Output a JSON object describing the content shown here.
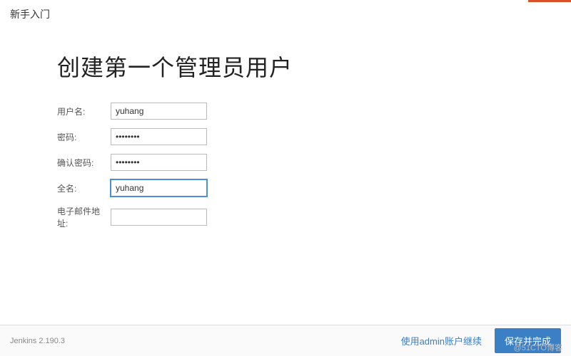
{
  "header": {
    "title": "新手入门"
  },
  "main": {
    "page_title": "创建第一个管理员用户",
    "form": {
      "username_label": "用户名:",
      "username_value": "yuhang",
      "password_label": "密码:",
      "password_value": "••••••••",
      "confirm_password_label": "确认密码:",
      "confirm_password_value": "••••••••",
      "fullname_label": "全名:",
      "fullname_value": "yuhang",
      "email_label": "电子邮件地址:",
      "email_value": ""
    }
  },
  "footer": {
    "version": "Jenkins 2.190.3",
    "skip_label": "使用admin账户继续",
    "save_label": "保存并完成"
  },
  "watermark": "@51CTO博客"
}
